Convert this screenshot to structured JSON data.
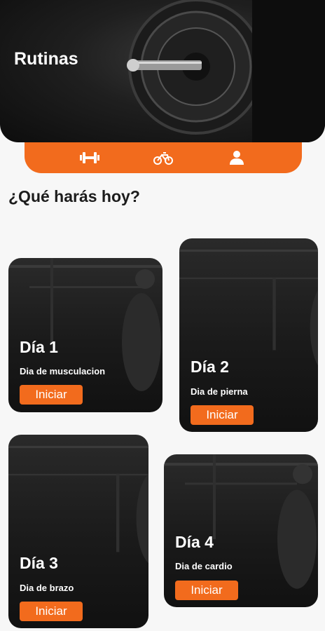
{
  "header": {
    "title": "Rutinas"
  },
  "tabs": [
    {
      "icon": "dumbbell-icon"
    },
    {
      "icon": "bicycle-icon"
    },
    {
      "icon": "user-icon"
    }
  ],
  "question": "¿Qué harás hoy?",
  "cards": [
    {
      "day": "Día 1",
      "subtitle": "Dia de musculacion",
      "button": "Iniciar"
    },
    {
      "day": "Día 2",
      "subtitle": "Dia de pierna",
      "button": "Iniciar"
    },
    {
      "day": "Día 3",
      "subtitle": "Dia de brazo",
      "button": "Iniciar"
    },
    {
      "day": "Día 4",
      "subtitle": "Dia de cardio",
      "button": "Iniciar"
    }
  ],
  "colors": {
    "accent": "#f26b1d",
    "background": "#f7f7f7"
  }
}
